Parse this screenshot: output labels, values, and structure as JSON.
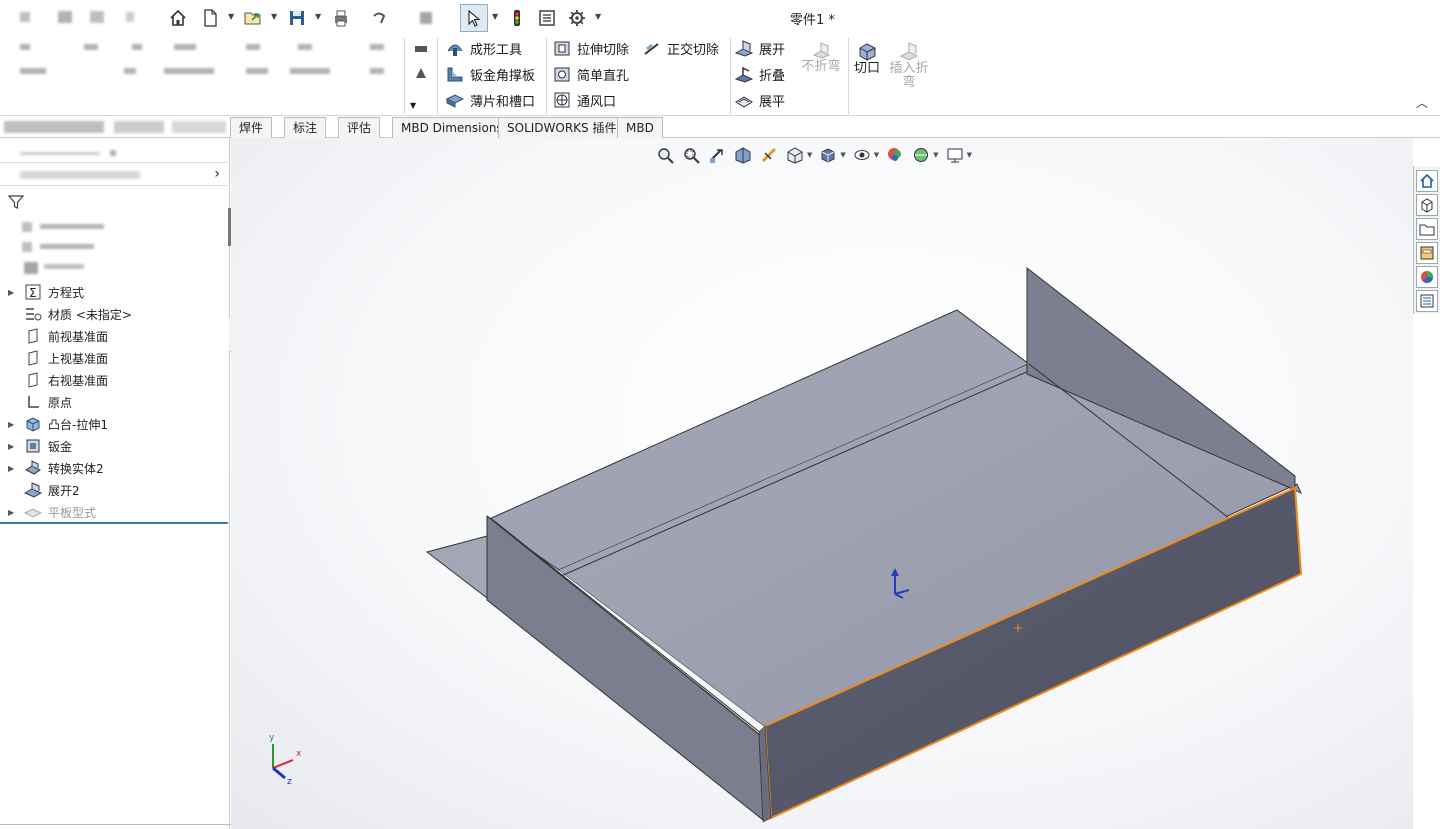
{
  "window": {
    "doc_title": "零件1 *"
  },
  "ribbon": {
    "group_forming": {
      "items": [
        "成形工具",
        "钣金角撑板",
        "薄片和槽口"
      ]
    },
    "group_cut": {
      "extrude_cut": "拉伸切除",
      "simple_hole": "简单直孔",
      "vent": "通风口",
      "normal_cut": "正交切除"
    },
    "group_unfold": {
      "unfold": "展开",
      "fold": "折叠",
      "flatten": "展平",
      "no_bends": "不折弯"
    },
    "rip": "切口",
    "insert_bends": "插入折弯"
  },
  "tabs": [
    "焊件",
    "标注",
    "评估",
    "MBD Dimensions",
    "SOLIDWORKS 插件",
    "MBD"
  ],
  "feature_tree": {
    "items": [
      {
        "label": "方程式",
        "icon": "equation-icon",
        "arrow": true
      },
      {
        "label": "材质 <未指定>",
        "icon": "material-icon",
        "arrow": false
      },
      {
        "label": "前视基准面",
        "icon": "plane-icon",
        "arrow": false
      },
      {
        "label": "上视基准面",
        "icon": "plane-icon",
        "arrow": false
      },
      {
        "label": "右视基准面",
        "icon": "plane-icon",
        "arrow": false
      },
      {
        "label": "原点",
        "icon": "origin-icon",
        "arrow": false
      },
      {
        "label": "凸台-拉伸1",
        "icon": "extrude-icon",
        "arrow": true
      },
      {
        "label": "钣金",
        "icon": "sheetmetal-icon",
        "arrow": true
      },
      {
        "label": "转换实体2",
        "icon": "convert-icon",
        "arrow": true
      },
      {
        "label": "展开2",
        "icon": "unfold-icon",
        "arrow": false
      },
      {
        "label": "平板型式",
        "icon": "flatpattern-icon",
        "arrow": true,
        "suppressed": true
      }
    ]
  },
  "triad": {
    "x": "x",
    "y": "y",
    "z": "z"
  },
  "colors": {
    "part_top": "#9a9eae",
    "part_side": "#7a7d8e",
    "part_dark": "#55586a",
    "selection": "#f08a1a",
    "accent_blue": "#3a7ea8"
  }
}
